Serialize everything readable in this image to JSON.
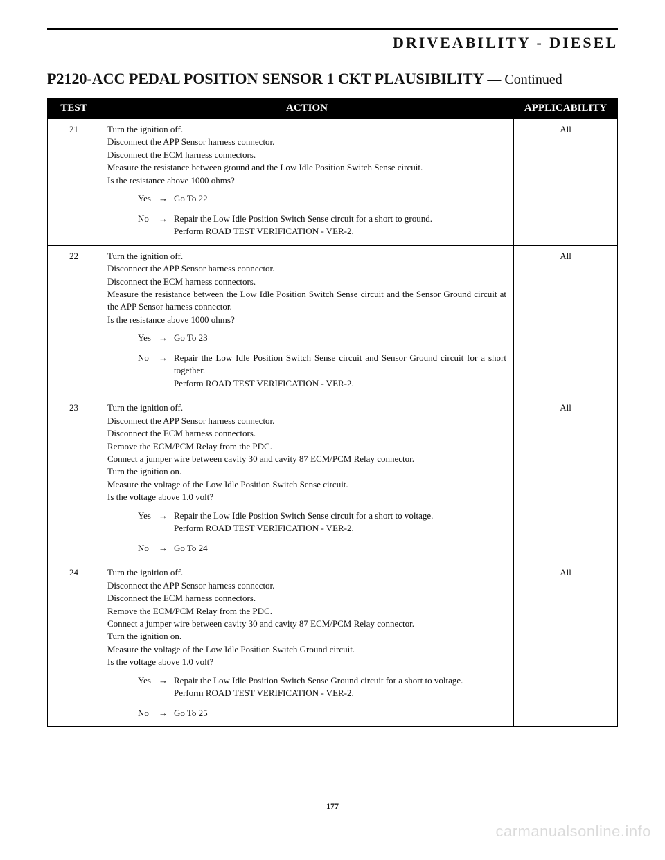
{
  "header": {
    "category": "DRIVEABILITY - DIESEL"
  },
  "section": {
    "title": "P2120-ACC PEDAL POSITION SENSOR 1 CKT PLAUSIBILITY",
    "continued": " — Continued"
  },
  "columns": {
    "test": "TEST",
    "action": "ACTION",
    "applicability": "APPLICABILITY"
  },
  "arrow": "→",
  "rows": [
    {
      "num": "21",
      "applicability": "All",
      "lines": [
        "Turn the ignition off.",
        "Disconnect the APP Sensor harness connector.",
        "Disconnect the ECM harness connectors.",
        "Measure the resistance between ground and the Low Idle Position Switch Sense circuit.",
        "Is the resistance above 1000 ohms?"
      ],
      "answers": [
        {
          "label": "Yes",
          "text": [
            "Go To  22"
          ]
        },
        {
          "label": "No",
          "text": [
            "Repair the Low Idle Position Switch Sense circuit for a short to ground.",
            "Perform ROAD TEST VERIFICATION - VER-2."
          ]
        }
      ]
    },
    {
      "num": "22",
      "applicability": "All",
      "lines": [
        "Turn the ignition off.",
        "Disconnect the APP Sensor harness connector.",
        "Disconnect the ECM harness connectors.",
        "Measure the resistance between the Low Idle Position Switch Sense circuit and the Sensor Ground circuit at the APP Sensor harness connector.",
        "Is the resistance above 1000 ohms?"
      ],
      "answers": [
        {
          "label": "Yes",
          "text": [
            "Go To  23"
          ]
        },
        {
          "label": "No",
          "text": [
            "Repair the Low Idle Position Switch Sense circuit and Sensor Ground circuit for a short together.",
            "Perform ROAD TEST VERIFICATION - VER-2."
          ]
        }
      ]
    },
    {
      "num": "23",
      "applicability": "All",
      "lines": [
        "Turn the ignition off.",
        "Disconnect the APP Sensor harness connector.",
        "Disconnect the ECM harness connectors.",
        "Remove the ECM/PCM Relay from the PDC.",
        "Connect a jumper wire between cavity 30 and cavity 87 ECM/PCM Relay connector.",
        "Turn the ignition on.",
        "Measure the voltage of the Low Idle Position Switch Sense circuit.",
        "Is the voltage above 1.0 volt?"
      ],
      "answers": [
        {
          "label": "Yes",
          "text": [
            "Repair the Low Idle Position Switch Sense circuit for a short to voltage.",
            "Perform ROAD TEST VERIFICATION - VER-2."
          ]
        },
        {
          "label": "No",
          "text": [
            "Go To  24"
          ]
        }
      ]
    },
    {
      "num": "24",
      "applicability": "All",
      "lines": [
        "Turn the ignition off.",
        "Disconnect the APP Sensor harness connector.",
        "Disconnect the ECM harness connectors.",
        "Remove the ECM/PCM Relay from the PDC.",
        "Connect a jumper wire between cavity 30 and cavity 87 ECM/PCM Relay connector.",
        "Turn the ignition on.",
        "Measure the voltage of the Low Idle Position Switch Ground circuit.",
        "Is the voltage above 1.0 volt?"
      ],
      "answers": [
        {
          "label": "Yes",
          "text": [
            "Repair the Low Idle Position Switch Sense Ground circuit for a short to voltage.",
            "Perform ROAD TEST VERIFICATION - VER-2."
          ]
        },
        {
          "label": "No",
          "text": [
            "Go To  25"
          ]
        }
      ]
    }
  ],
  "page_number": "177",
  "watermark": "carmanualsonline.info"
}
